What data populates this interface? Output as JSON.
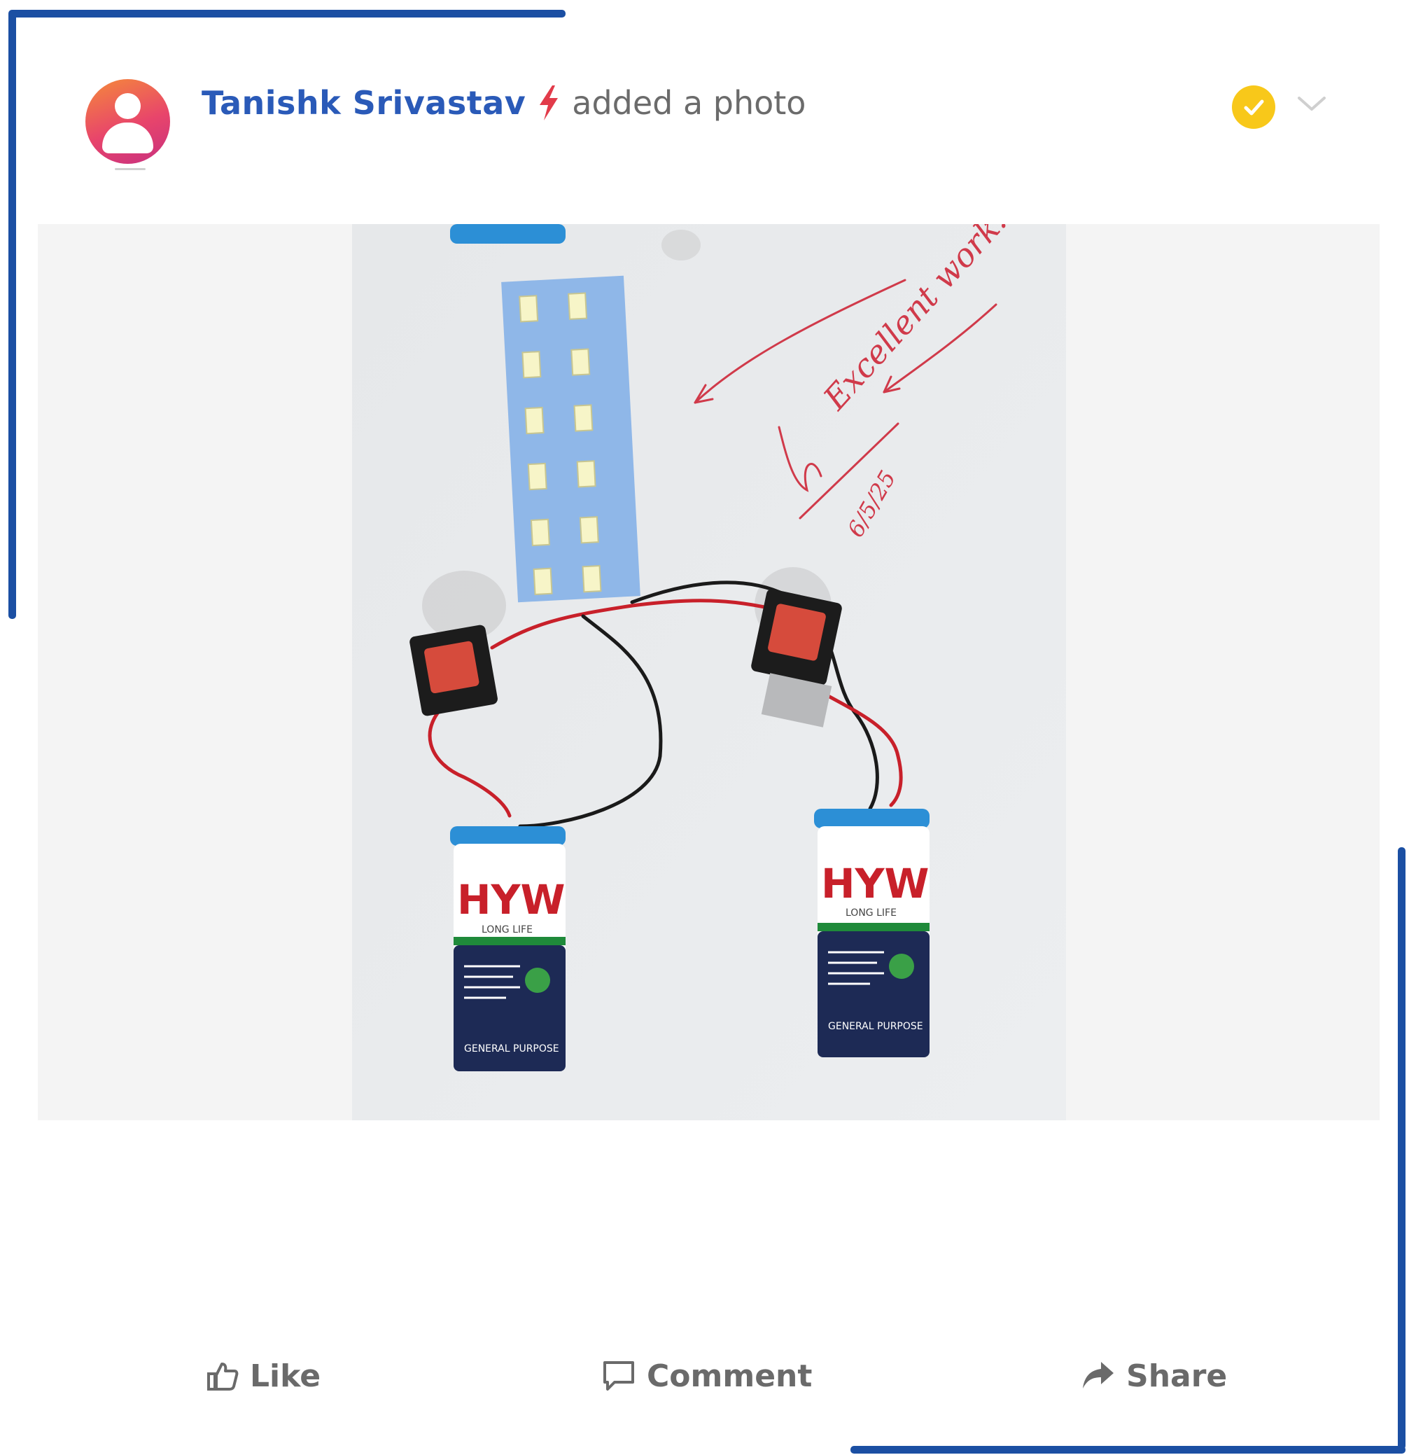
{
  "post": {
    "author": "Tanishk Srivastav",
    "action": "added a photo",
    "icons": {
      "avatar": "user-avatar-icon",
      "badge": "lightning-bolt-icon",
      "status": "verified-check-icon",
      "menu": "chevron-down-icon"
    }
  },
  "photo": {
    "annotation": "Excellent work!",
    "date": "6/5/25",
    "battery_brand": "HYW",
    "battery_tagline": "LONG LIFE",
    "battery_type": "GENERAL PURPOSE"
  },
  "actions": {
    "like": "Like",
    "comment": "Comment",
    "share": "Share"
  },
  "colors": {
    "frame": "#1b4fa3",
    "author": "#2a5ab8",
    "bolt": "#e23b4a",
    "verified": "#f8c81a"
  }
}
